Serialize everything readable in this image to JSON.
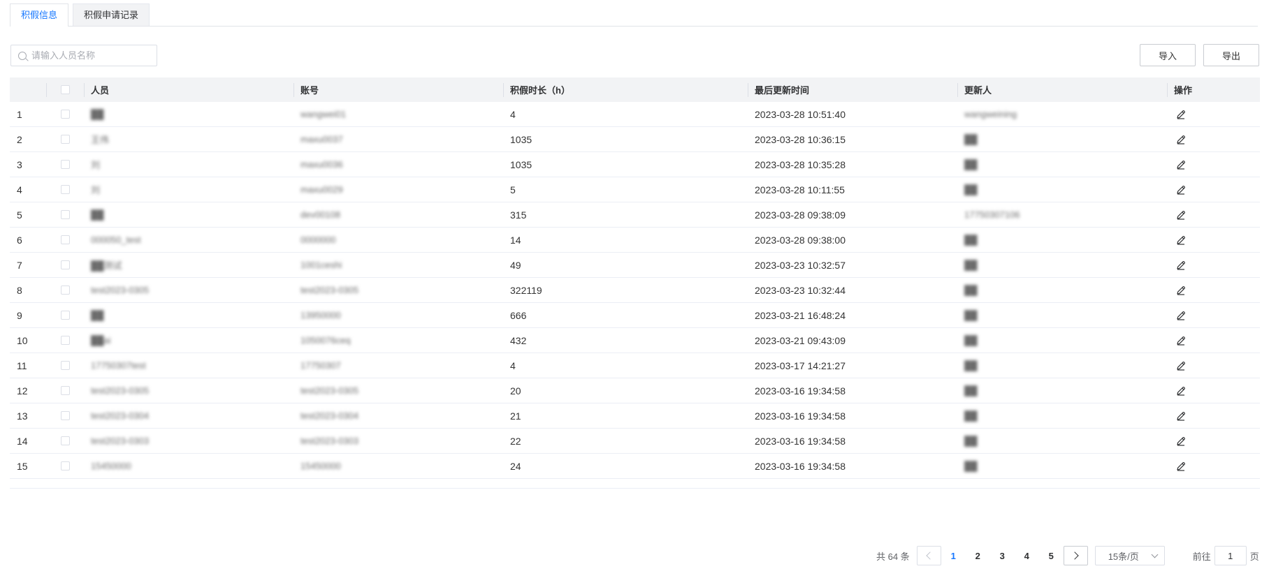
{
  "tabs": [
    {
      "label": "积假信息",
      "active": true
    },
    {
      "label": "积假申请记录",
      "active": false
    }
  ],
  "search": {
    "placeholder": "请输入人员名称",
    "value": ""
  },
  "toolbar": {
    "import_label": "导入",
    "export_label": "导出"
  },
  "table": {
    "columns": [
      "人员",
      "账号",
      "积假时长（h）",
      "最后更新时间",
      "更新人",
      "操作"
    ],
    "rows": [
      {
        "index": "1",
        "name": "██",
        "account": "wangwei01",
        "duration": "4",
        "updated_at": "2023-03-28 10:51:40",
        "updater": "wangweining"
      },
      {
        "index": "2",
        "name": "王伟",
        "account": "maxu0037",
        "duration": "1035",
        "updated_at": "2023-03-28 10:36:15",
        "updater": "██"
      },
      {
        "index": "3",
        "name": "刘",
        "account": "maxu0036",
        "duration": "1035",
        "updated_at": "2023-03-28 10:35:28",
        "updater": "██"
      },
      {
        "index": "4",
        "name": "刘",
        "account": "maxu0029",
        "duration": "5",
        "updated_at": "2023-03-28 10:11:55",
        "updater": "██"
      },
      {
        "index": "5",
        "name": "██",
        "account": "dev00108",
        "duration": "315",
        "updated_at": "2023-03-28 09:38:09",
        "updater": "17750307106"
      },
      {
        "index": "6",
        "name": "000050_test",
        "account": "0000000",
        "duration": "14",
        "updated_at": "2023-03-28 09:38:00",
        "updater": "██"
      },
      {
        "index": "7",
        "name": "██测试",
        "account": "1001ceshi",
        "duration": "49",
        "updated_at": "2023-03-23 10:32:57",
        "updater": "██"
      },
      {
        "index": "8",
        "name": "test2023-0305",
        "account": "test2023-0305",
        "duration": "322119",
        "updated_at": "2023-03-23 10:32:44",
        "updater": "██"
      },
      {
        "index": "9",
        "name": "██",
        "account": "13950000",
        "duration": "666",
        "updated_at": "2023-03-21 16:48:24",
        "updater": "██"
      },
      {
        "index": "10",
        "name": "██ai",
        "account": "1050076ceq",
        "duration": "432",
        "updated_at": "2023-03-21 09:43:09",
        "updater": "██"
      },
      {
        "index": "11",
        "name": "17750307test",
        "account": "17750307",
        "duration": "4",
        "updated_at": "2023-03-17 14:21:27",
        "updater": "██"
      },
      {
        "index": "12",
        "name": "test2023-0305",
        "account": "test2023-0305",
        "duration": "20",
        "updated_at": "2023-03-16 19:34:58",
        "updater": "██"
      },
      {
        "index": "13",
        "name": "test2023-0304",
        "account": "test2023-0304",
        "duration": "21",
        "updated_at": "2023-03-16 19:34:58",
        "updater": "██"
      },
      {
        "index": "14",
        "name": "test2023-0303",
        "account": "test2023-0303",
        "duration": "22",
        "updated_at": "2023-03-16 19:34:58",
        "updater": "██"
      },
      {
        "index": "15",
        "name": "15450000",
        "account": "15450000",
        "duration": "24",
        "updated_at": "2023-03-16 19:34:58",
        "updater": "██"
      }
    ]
  },
  "pagination": {
    "total_text": "共 64 条",
    "pages": [
      "1",
      "2",
      "3",
      "4",
      "5"
    ],
    "current_page": "1",
    "page_size": "15条/页",
    "goto_prefix": "前往",
    "goto_value": "1",
    "goto_suffix": "页"
  },
  "colors": {
    "accent": "#1677ff",
    "header_bg": "#f2f3f5",
    "border": "#ebeef5"
  },
  "icons": {
    "search": "search-icon",
    "edit": "edit-icon",
    "prev": "chevron-left-icon",
    "next": "chevron-right-icon",
    "dropdown": "chevron-down-icon"
  }
}
